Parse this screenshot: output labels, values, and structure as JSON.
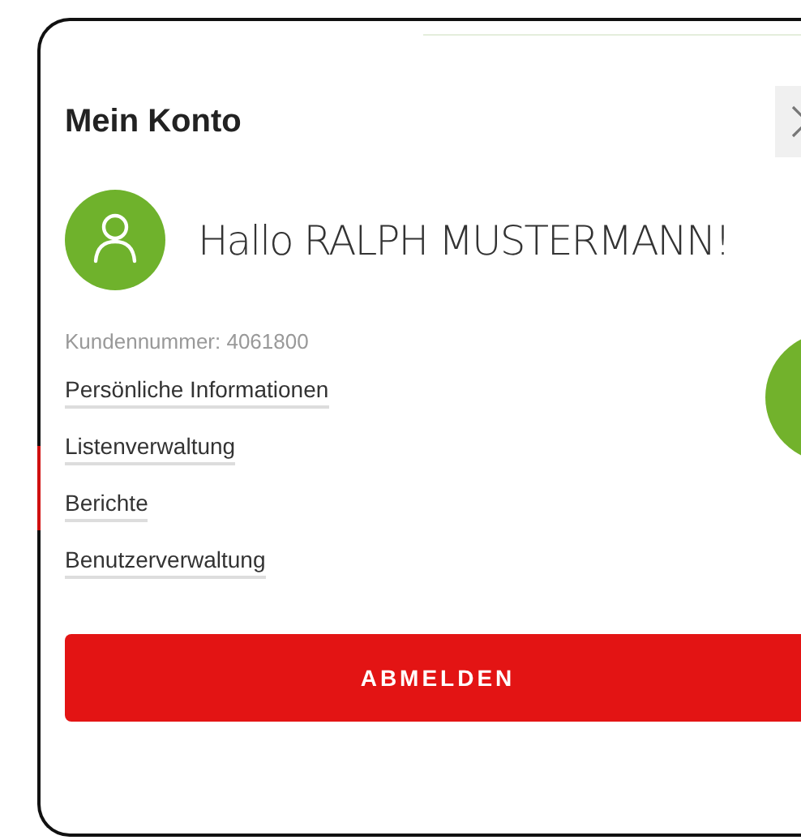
{
  "panel": {
    "title": "Mein Konto",
    "greeting": "Hallo RALPH MUSTERMANN!",
    "customer_number": "Kundennummer: 4061800"
  },
  "links": [
    {
      "label": "Persönliche Informationen"
    },
    {
      "label": "Listenverwaltung"
    },
    {
      "label": "Berichte"
    },
    {
      "label": "Benutzerverwaltung"
    }
  ],
  "logout_button": {
    "label": "ABMELDEN"
  }
}
